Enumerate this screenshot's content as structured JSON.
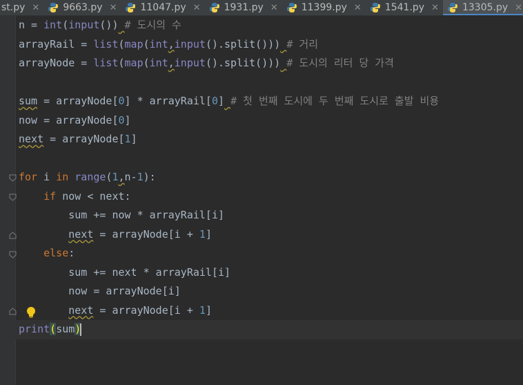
{
  "tabs": [
    {
      "label": "st.py",
      "active": false,
      "icon": "python-file-icon"
    },
    {
      "label": "9663.py",
      "active": false,
      "icon": "python-file-icon"
    },
    {
      "label": "11047.py",
      "active": false,
      "icon": "python-file-icon"
    },
    {
      "label": "1931.py",
      "active": false,
      "icon": "python-file-icon"
    },
    {
      "label": "11399.py",
      "active": false,
      "icon": "python-file-icon"
    },
    {
      "label": "1541.py",
      "active": false,
      "icon": "python-file-icon"
    },
    {
      "label": "13305.py",
      "active": true,
      "icon": "python-file-icon"
    }
  ],
  "close_glyph": "✕",
  "code": {
    "l1": {
      "a": "n = ",
      "b": "int",
      "c": "(",
      "d": "input",
      "e": "())",
      "f": " ",
      "g": "# 도시의 수"
    },
    "l2": {
      "a": "arrayRail = ",
      "b": "list",
      "c": "(",
      "d": "map",
      "e": "(",
      "f": "int",
      ",": ",",
      "g": "input",
      "h": "().split()))",
      "i": " ",
      "j": "# 거리"
    },
    "l3": {
      "a": "arrayNode = ",
      "b": "list",
      "c": "(",
      "d": "map",
      "e": "(",
      "f": "int",
      ",": ",",
      "g": "input",
      "h": "().split()))",
      "i": " ",
      "j": "# 도시의 리터 당 가격"
    },
    "l5": {
      "a": "sum",
      "b": " = arrayNode[",
      "c": "0",
      "d": "] * arrayRail[",
      "e": "0",
      "f": "]",
      "g": " ",
      "h": "# 첫 번째 도시에 두 번째 도시로 출발 비용"
    },
    "l6": {
      "a": "now = arrayNode[",
      "b": "0",
      "c": "]"
    },
    "l7": {
      "a": "next",
      "b": " = arrayNode[",
      "c": "1",
      "d": "]"
    },
    "l9": {
      "a": "for",
      "b": " i ",
      "c": "in",
      "d": " ",
      "e": "range",
      "f": "(",
      "g": "1",
      ",": ",",
      "h": "n-",
      "i": "1",
      "j": "):"
    },
    "l10": {
      "a": "    ",
      "b": "if",
      "c": " now < next:"
    },
    "l11": {
      "a": "        sum += now * arrayRail[i]"
    },
    "l12": {
      "a": "        ",
      "b": "next",
      "c": " = arrayNode[i + ",
      "d": "1",
      "e": "]"
    },
    "l13": {
      "a": "    ",
      "b": "else",
      "c": ":"
    },
    "l14": {
      "a": "        sum += next * arrayRail[i]"
    },
    "l15": {
      "a": "        now = arrayNode[i]"
    },
    "l16": {
      "a": "        ",
      "b": "next",
      "c": " = arrayNode[i + ",
      "d": "1",
      "e": "]"
    },
    "l17": {
      "a": "print",
      "b": "(",
      "c": "sum",
      "d": ")"
    }
  },
  "colors": {
    "background": "#2b2b2b",
    "keyword": "#cc7832",
    "builtin": "#8888c6",
    "number": "#6897bb",
    "comment": "#808080",
    "text": "#a9b7c6",
    "active_tab_underline": "#4a88c7"
  }
}
